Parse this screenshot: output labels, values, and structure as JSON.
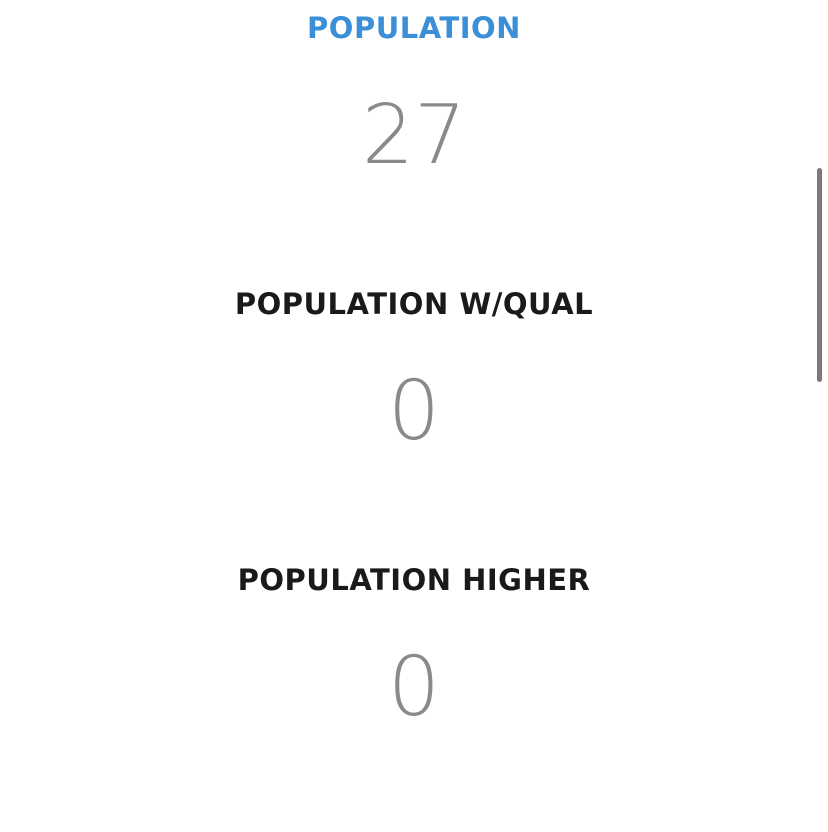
{
  "stats": [
    {
      "label": "POPULATION",
      "value": "27"
    },
    {
      "label": "POPULATION W/QUAL",
      "value": "0"
    },
    {
      "label": "POPULATION HIGHER",
      "value": "0"
    }
  ],
  "colors": {
    "active_label": "#3a8fd6",
    "label": "#1a1a1a",
    "value": "#8a8a8a",
    "scrollbar": "#7a7a7a"
  }
}
